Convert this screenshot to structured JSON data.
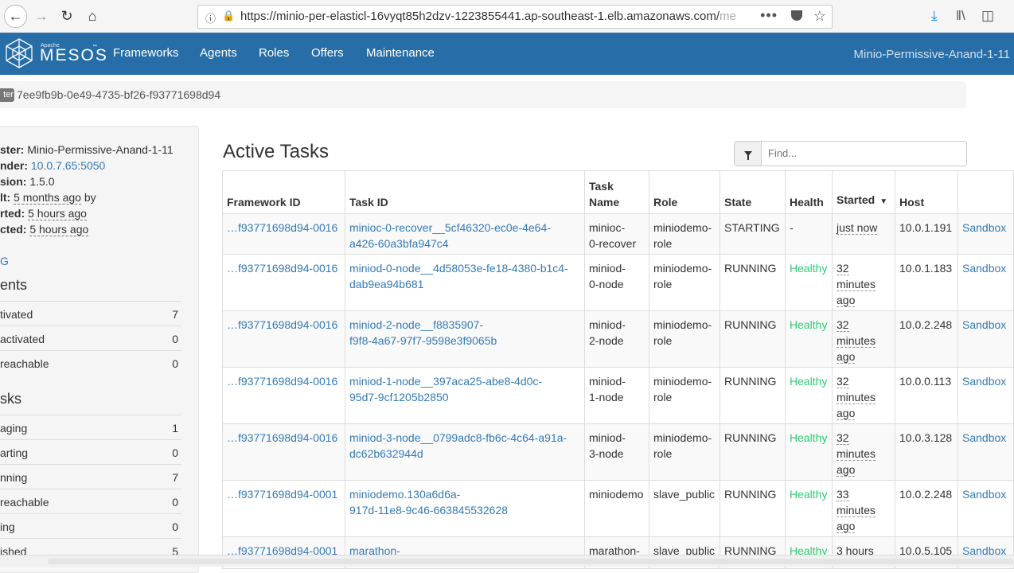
{
  "browser": {
    "url_main": "https://minio-per-elasticl-16vyqt85h2dzv-1223855441.ap-southeast-1.elb.amazonaws.com/",
    "url_faded": "me",
    "menu_dots": "•••",
    "icons": [
      "back-arrow-icon",
      "forward-arrow-icon",
      "reload-icon",
      "home-icon",
      "info-icon",
      "lock-warning-icon",
      "page-actions-icon",
      "pocket-icon",
      "bookmark-star-icon",
      "download-icon",
      "library-icon",
      "sidebar-icon"
    ]
  },
  "navbar": {
    "brand_small": "Apache",
    "brand": "MESOS",
    "trademark": "™",
    "items": [
      "Frameworks",
      "Agents",
      "Roles",
      "Offers",
      "Maintenance"
    ],
    "cluster": "Minio-Permissive-Anand-1-11",
    "color": "#276ea8"
  },
  "breadcrumb": {
    "badge": "ter",
    "id": "7ee9fb9b-0e49-4735-bf26-f93771698d94"
  },
  "sidebar": {
    "cluster_label": "ster:",
    "cluster_value": "Minio-Permissive-Anand-1-11",
    "leader_label": "nder:",
    "leader_value": "10.0.7.65:5050",
    "version_label": "sion:",
    "version_value": "1.5.0",
    "built_label": "lt:",
    "built_value": "5 months ago",
    "built_suffix": "by",
    "started_label": "rted:",
    "started_value": "5 hours ago",
    "elected_label": "cted:",
    "elected_value": "5 hours ago",
    "log_link": "G",
    "agents_title": "ents",
    "agents": [
      {
        "label": "tivated",
        "value": "7"
      },
      {
        "label": "activated",
        "value": "0"
      },
      {
        "label": "reachable",
        "value": "0"
      }
    ],
    "tasks_title": "sks",
    "tasks": [
      {
        "label": "aging",
        "value": "1"
      },
      {
        "label": "arting",
        "value": "0"
      },
      {
        "label": "nning",
        "value": "7"
      },
      {
        "label": "reachable",
        "value": "0"
      },
      {
        "label": "ing",
        "value": "0"
      },
      {
        "label": "ished",
        "value": "5"
      }
    ]
  },
  "main": {
    "title": "Active Tasks",
    "find_placeholder": "Find...",
    "columns": {
      "framework_id": "Framework ID",
      "task_id": "Task ID",
      "task_name_1": "Task",
      "task_name_2": "Name",
      "role": "Role",
      "state": "State",
      "health": "Health",
      "started": "Started",
      "started_sort": "▼",
      "host": "Host"
    },
    "rows": [
      {
        "fw": "…f93771698d94-0016",
        "tid1": "minioc-0-recover__5cf46320-ec0e-4e64-",
        "tid2": "a426-60a3bfa947c4",
        "name1": "minioc-",
        "name2": "0-recover",
        "role1": "miniodemo-",
        "role2": "role",
        "state": "STARTING",
        "health": "-",
        "started": [
          "just now"
        ],
        "host": "10.0.1.191",
        "sandbox": "Sandbox"
      },
      {
        "fw": "…f93771698d94-0016",
        "tid1": "miniod-0-node__4d58053e-fe18-4380-b1c4-",
        "tid2": "dab9ea94b681",
        "name1": "miniod-",
        "name2": "0-node",
        "role1": "miniodemo-",
        "role2": "role",
        "state": "RUNNING",
        "health": "Healthy",
        "started": [
          "32",
          "minutes",
          "ago"
        ],
        "host": "10.0.1.183",
        "sandbox": "Sandbox"
      },
      {
        "fw": "…f93771698d94-0016",
        "tid1": "miniod-2-node__f8835907-",
        "tid2": "f9f8-4a67-97f7-9598e3f9065b",
        "name1": "miniod-",
        "name2": "2-node",
        "role1": "miniodemo-",
        "role2": "role",
        "state": "RUNNING",
        "health": "Healthy",
        "started": [
          "32",
          "minutes",
          "ago"
        ],
        "host": "10.0.2.248",
        "sandbox": "Sandbox"
      },
      {
        "fw": "…f93771698d94-0016",
        "tid1": "miniod-1-node__397aca25-abe8-4d0c-",
        "tid2": "95d7-9cf1205b2850",
        "name1": "miniod-",
        "name2": "1-node",
        "role1": "miniodemo-",
        "role2": "role",
        "state": "RUNNING",
        "health": "Healthy",
        "started": [
          "32",
          "minutes",
          "ago"
        ],
        "host": "10.0.0.113",
        "sandbox": "Sandbox"
      },
      {
        "fw": "…f93771698d94-0016",
        "tid1": "miniod-3-node__0799adc8-fb6c-4c64-a91a-",
        "tid2": "dc62b632944d",
        "name1": "miniod-",
        "name2": "3-node",
        "role1": "miniodemo-",
        "role2": "role",
        "state": "RUNNING",
        "health": "Healthy",
        "started": [
          "32",
          "minutes",
          "ago"
        ],
        "host": "10.0.3.128",
        "sandbox": "Sandbox"
      },
      {
        "fw": "…f93771698d94-0001",
        "tid1": "miniodemo.130a6d6a-",
        "tid2": "917d-11e8-9c46-663845532628",
        "name1": "miniodemo",
        "name2": "",
        "role1": "slave_public",
        "role2": "",
        "state": "RUNNING",
        "health": "Healthy",
        "started": [
          "33",
          "minutes",
          "ago"
        ],
        "host": "10.0.2.248",
        "sandbox": "Sandbox"
      },
      {
        "fw": "…f93771698d94-0001",
        "tid1": "marathon-",
        "tid2": "",
        "name1": "marathon-",
        "name2": "",
        "role1": "slave_public",
        "role2": "",
        "state": "RUNNING",
        "health": "Healthy",
        "started": [
          "3 hours"
        ],
        "host": "10.0.5.105",
        "sandbox": "Sandbox"
      }
    ]
  },
  "colors": {
    "link": "#337ab7",
    "healthy": "#2ecc71"
  }
}
